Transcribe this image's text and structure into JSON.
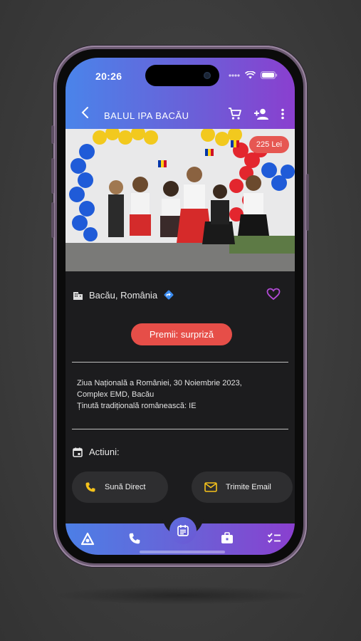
{
  "status_bar": {
    "time": "20:26"
  },
  "app_bar": {
    "title": "BALUL IPA BACĂU"
  },
  "event": {
    "price": "225 Lei",
    "location": "Bacău, România",
    "prize": "Premii: surpriză",
    "description": [
      "Ziua Națională a României, 30 Noiembrie 2023,",
      "Complex EMD, Bacău",
      "Ținută tradițională românească: IE"
    ]
  },
  "actions": {
    "label": "Actiuni:",
    "call_label": "Sună Direct",
    "email_label": "Trimite Email"
  },
  "colors": {
    "accent_blue": "#4a84ea",
    "accent_purple": "#8a3fcf",
    "cta_red": "#e64e48",
    "icon_yellow": "#f5c21b",
    "heart_purple": "#b24bd6"
  },
  "nav": [
    "app-logo-icon",
    "phone-icon",
    "calendar-icon",
    "briefcase-icon",
    "checklist-icon"
  ]
}
